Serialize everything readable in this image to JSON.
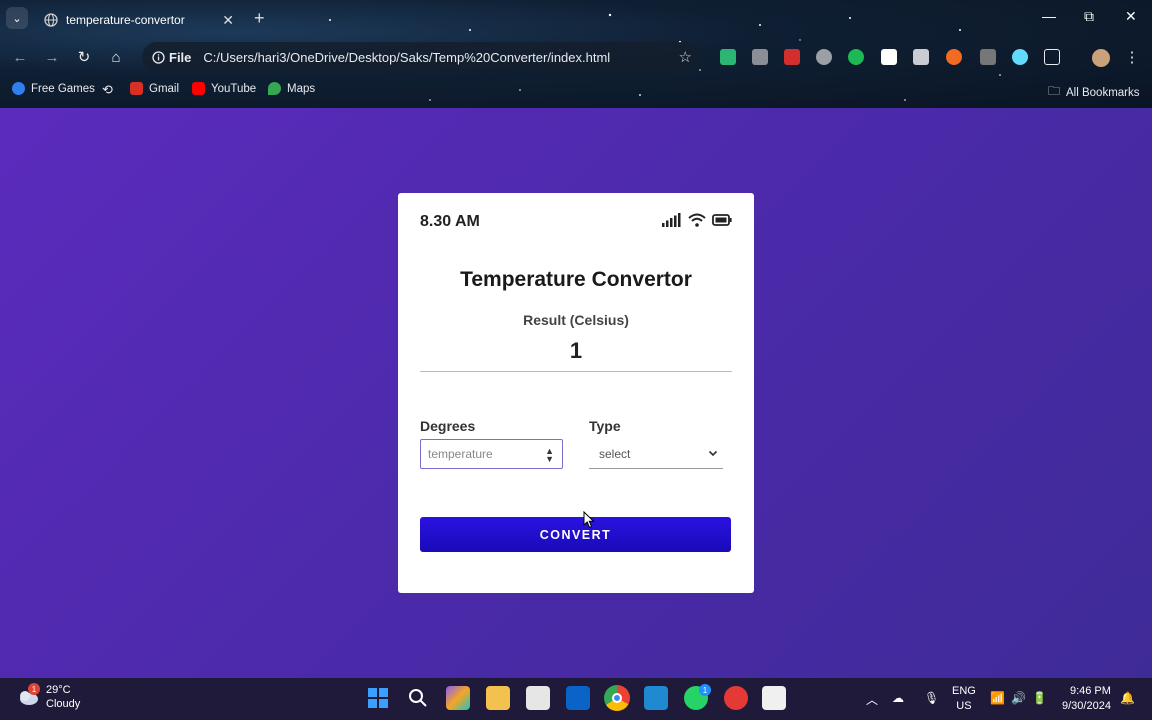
{
  "browser": {
    "tab_title": "temperature-convertor",
    "url_chip": "File",
    "url": "C:/Users/hari3/OneDrive/Desktop/Saks/Temp%20Converter/index.html",
    "bookmarks": [
      {
        "label": "Free Games",
        "icon": "edge-games-icon",
        "color": "#2f80ed"
      },
      {
        "label": "Gmail",
        "icon": "gmail-icon",
        "color": "#d93025"
      },
      {
        "label": "YouTube",
        "icon": "youtube-icon",
        "color": "#ff0000"
      },
      {
        "label": "Maps",
        "icon": "maps-icon",
        "color": "#34a853"
      }
    ],
    "all_bookmarks": "All Bookmarks"
  },
  "app": {
    "status_time": "8.30 AM",
    "title": "Temperature Convertor",
    "result_label": "Result (Celsius)",
    "result_value": "1",
    "degrees_label": "Degrees",
    "degrees_placeholder": "temperature",
    "type_label": "Type",
    "type_selected": "select",
    "convert_label": "CONVERT",
    "accent_color": "#1f0ccc",
    "background_color": "#4a2aa8"
  },
  "taskbar": {
    "weather_temp": "29°C",
    "weather_desc": "Cloudy",
    "weather_badge": "1",
    "whatsapp_badge": "1",
    "lang_line1": "ENG",
    "lang_line2": "US",
    "time": "9:46 PM",
    "date": "9/30/2024"
  }
}
